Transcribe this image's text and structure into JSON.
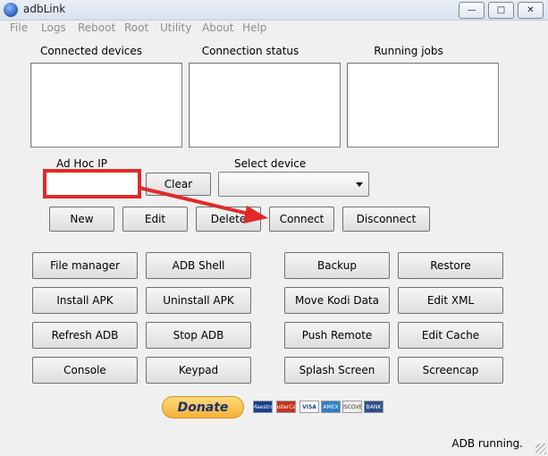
{
  "window": {
    "title": "adbLink",
    "minimize_icon": "—",
    "maximize_icon": "□",
    "close_icon": "✕"
  },
  "menu": [
    "File",
    "Logs",
    "Reboot",
    "Root",
    "Utility",
    "About",
    "Help"
  ],
  "panels": {
    "connected_devices": "Connected devices",
    "connection_status": "Connection status",
    "running_jobs": "Running jobs"
  },
  "adhoc": {
    "label": "Ad Hoc IP",
    "value": "",
    "clear": "Clear"
  },
  "select_device": {
    "label": "Select device",
    "value": ""
  },
  "device_buttons": {
    "new": "New",
    "edit": "Edit",
    "delete": "Delete",
    "connect": "Connect",
    "disconnect": "Disconnect"
  },
  "tools": {
    "file_manager": "File manager",
    "adb_shell": "ADB Shell",
    "backup": "Backup",
    "restore": "Restore",
    "install_apk": "Install APK",
    "uninstall_apk": "Uninstall APK",
    "move_kodi_data": "Move Kodi Data",
    "edit_xml": "Edit XML",
    "refresh_adb": "Refresh ADB",
    "stop_adb": "Stop ADB",
    "push_remote": "Push Remote",
    "edit_cache": "Edit Cache",
    "console": "Console",
    "keypad": "Keypad",
    "splash_screen": "Splash Screen",
    "screencap": "Screencap"
  },
  "donate": "Donate",
  "payment_cards": [
    "Maestro",
    "MasterCard",
    "VISA",
    "AMEX",
    "DISCOVER",
    "BANK"
  ],
  "status": "ADB running.",
  "colors": {
    "annotation_red": "#e02a2a"
  }
}
